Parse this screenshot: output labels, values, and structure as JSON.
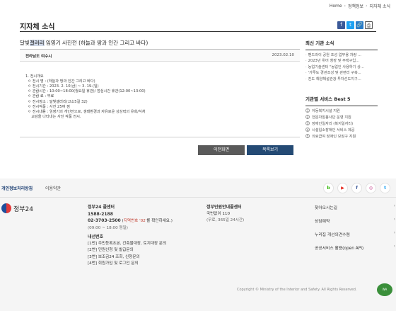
{
  "breadcrumb": {
    "home": "Home",
    "level1": "정책정보",
    "level2": "지자체 소식"
  },
  "page_title": "지자체 소식",
  "share": {
    "facebook_icon": "f",
    "twitter_icon": "t",
    "link_icon": "🔗",
    "print_icon": "⎙"
  },
  "article": {
    "title_pre": "달빛",
    "title_hl": "갤러리",
    "title_post": " 임영기 사진전 (하늘과 땅과 인간 그리고 바다)",
    "org": "전라남도 여수시",
    "date": "2023.02.10",
    "body_lines": [
      "1. 전시개요",
      "  ㅇ 전시 명 : (하늘과 땅과 인간 그리고 바다)",
      "  ㅇ 전시기간 : 2023. 2. 10(금) ~ 3. 19.(일)",
      "  ㅇ 관람시간 : 10:00~18:00(월요일 휴관)/ 점심시간 휴관(12:00~13:00)",
      "  ㅇ 관람 료 : 무료",
      "  ㅇ 전시장소 : 달빛갤러리(고소5길 32)",
      "  ㅇ 전시작품 : 사진 25여 점",
      "  ㅇ 전시내용 : 임영기의 개인전으로, 생태환경과 자유로운 상상력의 유희/식처",
      "     교감을 나타내는 사진 작품 전시."
    ]
  },
  "buttons": {
    "prev": "이전화면",
    "list": "목록보기"
  },
  "sidebar": {
    "latest_title": "최신 기관 소식",
    "latest_items": [
      "팬드라이 공원 조성 업무용 차량 ...",
      "2023년 위어 청장 및 주택구입...",
      "농업기술센터 \"농업인 사용하기 상...",
      "'가루도 경관조성 및 관련리 구축...",
      "진도 해양해설관광 투자선도지구..."
    ],
    "best_title": "기관별 서비스 Best 5",
    "best_items": [
      "아동복지시설 지원",
      "전문자원봉사단 운영 지원",
      "장애인일자리 (복지일자리)",
      "시설입소장애인 서비스 제공",
      "의료급여 장애인 보장구 지원"
    ]
  },
  "footer": {
    "privacy_link": "개인정보처리방침",
    "terms_link": "이용약관",
    "sns": [
      "b",
      "▶",
      "f",
      "◎",
      "t"
    ],
    "logo_text": "정부24",
    "call_center": {
      "title": "정부24 콜센터",
      "phone1": "1588-2188",
      "phone2": "02-3703-2500",
      "phone2_note_pre": "(",
      "phone2_note_red": "지역번호 '02'",
      "phone2_note_post": "를 확인하세요.)",
      "hours": "(09:00 ~ 18:00 평일)",
      "ext_title": "내선번호",
      "ext": [
        "[1번] 주민등록초본, 건축물대장, 토지대장 문의",
        "[2번] 민원신청 및 발급문의",
        "[3번] 보조금24 조회, 신청문의",
        "[4번] 회원가입 및 로그인 문의"
      ]
    },
    "petition_center": {
      "title": "정부민원안내콜센터",
      "phone": "국번없이 110",
      "hours": "(무료, 365일 24시간)"
    },
    "quick_links": [
      "찾아오시는길",
      "상담예약",
      "누리집 개선의견수렴",
      "공공서비스 활용(open API)"
    ],
    "copyright": "Copyright © Ministry of the Interior and Safety. All Rights Reserved.",
    "wa_mark": "WA"
  }
}
